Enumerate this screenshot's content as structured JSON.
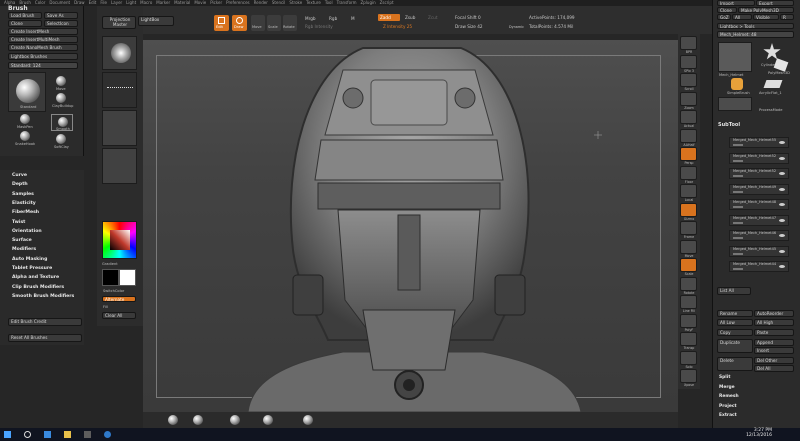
{
  "menu": [
    "Alpha",
    "Brush",
    "Color",
    "Document",
    "Draw",
    "Edit",
    "File",
    "Layer",
    "Light",
    "Macro",
    "Marker",
    "Material",
    "Movie",
    "Picker",
    "Preferences",
    "Render",
    "Stencil",
    "Stroke",
    "Texture",
    "Tool",
    "Transform",
    "Zplugin",
    "Zscript"
  ],
  "brush_panel": {
    "title": "Brush",
    "load": "Load Brush",
    "save_as": "Save As",
    "clone": "Clone",
    "select_icon": "SelectIcon",
    "create_insert_mesh": "Create InsertMesh",
    "create_insert_multi": "Create InsertMultiMesh",
    "create_nano": "Create NanoMesh Brush",
    "lightbox": "Lightbox Brushes",
    "standard": "Standard: 124",
    "brushes": [
      "Standard",
      "Move",
      "ClayBuildup",
      "MaskPen",
      "Smooth",
      "SelectLasso",
      "SnakeHook",
      "SoftClay",
      "Inflat"
    ]
  },
  "submenus": [
    "Curve",
    "Depth",
    "Samples",
    "Elasticity",
    "FiberMesh",
    "Twist",
    "Orientation",
    "Surface",
    "Modifiers",
    "Auto Masking",
    "Tablet Pressure",
    "Alpha and Texture",
    "Clip Brush Modifiers",
    "Smooth Brush Modifiers"
  ],
  "edit_brush_credit": "Edit Brush Credit",
  "reset_brushes": "Reset All Brushes",
  "tool_column": {
    "projection_master": "Projection Master",
    "lightbox": "LightBox",
    "gradient": "Gradient",
    "switch_color": "SwitchColor",
    "alternate": "Alternate",
    "main_color": "Fill",
    "clear_all": "Clear All"
  },
  "toolbar": {
    "edit": "Edit",
    "draw": "Draw",
    "move": "Move",
    "scale": "Scale",
    "rotate": "Rotate",
    "mrgb": "Mrgb",
    "rgb": "Rgb",
    "m": "M",
    "rgb_intensity": "Rgb Intensity",
    "zadd": "Zadd",
    "zsub": "Zsub",
    "zcut": "Zcut",
    "z_intensity": "Z Intensity 25",
    "focal_shift": "Focal Shift 0",
    "draw_size": "Draw Size 42",
    "dynamic": "Dynamic",
    "active_points": "ActivePoints: 174,099",
    "total_points": "TotalPoints: 4.574 Mil"
  },
  "right_icons": [
    "BPR",
    "SPix 3",
    "Scroll",
    "Zoom",
    "Actual",
    "AAHalf",
    "Persp",
    "Floor",
    "Local",
    "Gizmo",
    "Frame",
    "Move",
    "Scale",
    "Rotate",
    "Line Fill",
    "PolyF",
    "Transp",
    "Solo",
    "Xpose"
  ],
  "tool_panel": {
    "import": "Import",
    "export": "Export",
    "clone": "Clone",
    "make_polymesh": "Make PolyMesh3D",
    "goz": "GoZ",
    "all": "All",
    "visible": "Visible",
    "r": "R",
    "lightbox_tools": "Lightbox > Tools",
    "current_tool": "Mech_Helmet: 48",
    "thumbs": [
      "Mech_Helmet",
      "Cylinder3D",
      "PolyMesh3D",
      "SimpleBrush",
      "AcrylicFlat_1",
      "Mech_Helmet",
      "ProcessMode"
    ],
    "subtool_title": "SubTool",
    "subtools": [
      "Merged_Mech_Helmet55",
      "Merged_Mech_Helmet52",
      "Merged_Mech_Helmet52",
      "Merged_Mech_Helmet49",
      "Merged_Mech_Helmet48",
      "Merged_Mech_Helmet47",
      "Merged_Mech_Helmet46",
      "Merged_Mech_Helmet45",
      "Merged_Mech_Helmet44"
    ],
    "list_all": "List All",
    "rename": "Rename",
    "autoreorder": "AutoReorder",
    "all_low": "All Low",
    "all_high": "All High",
    "copy": "Copy",
    "paste": "Paste",
    "duplicate": "Duplicate",
    "append": "Append",
    "insert": "Insert",
    "delete": "Delete",
    "del_other": "Del Other",
    "del_all": "Del All",
    "split": "Split",
    "merge": "Merge",
    "remesh": "Remesh",
    "project": "Project",
    "extract": "Extract"
  },
  "clock": {
    "time": "3:27 PM",
    "date": "12/13/2016"
  },
  "colors": {
    "accent": "#d9731e",
    "panel": "#2b2b2b",
    "canvas": "#454545"
  }
}
